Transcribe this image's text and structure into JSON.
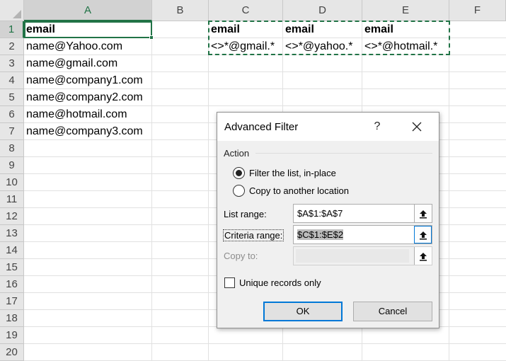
{
  "sheet": {
    "columns": [
      "A",
      "B",
      "C",
      "D",
      "E",
      "F"
    ],
    "rows": [
      "1",
      "2",
      "3",
      "4",
      "5",
      "6",
      "7",
      "8",
      "9",
      "10",
      "11",
      "12",
      "13",
      "14",
      "15",
      "16",
      "17",
      "18",
      "19",
      "20"
    ],
    "column_a": [
      "email",
      "name@Yahoo.com",
      "name@gmail.com",
      "name@company1.com",
      "name@company2.com",
      "name@hotmail.com",
      "name@company3.com"
    ],
    "criteria_headers": [
      "email",
      "email",
      "email"
    ],
    "criteria_values": [
      "<>*@gmail.*",
      "<>*@yahoo.*",
      "<>*@hotmail.*"
    ]
  },
  "dialog": {
    "title": "Advanced Filter",
    "help": "?",
    "action_group": "Action",
    "radio_filter_in_place": "Filter the list, in-place",
    "radio_copy": "Copy to another location",
    "list_range_label": "List range:",
    "list_range_value": "$A$1:$A$7",
    "criteria_range_label": "Criteria range:",
    "criteria_range_value": "$C$1:$E$2",
    "copy_to_label": "Copy to:",
    "copy_to_value": "",
    "unique_label": "Unique records only",
    "ok": "OK",
    "cancel": "Cancel",
    "selected_action": "filter_in_place",
    "unique_checked": false
  },
  "colors": {
    "accent": "#217346",
    "focus": "#0078d7"
  }
}
